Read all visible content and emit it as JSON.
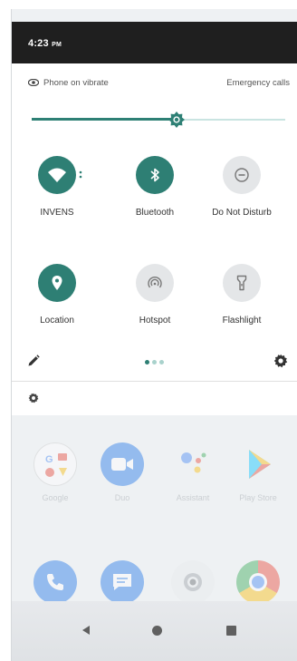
{
  "status_bar": {
    "time": "4:23",
    "ampm": "PM"
  },
  "quick_settings": {
    "ringer_status": "Phone on vibrate",
    "emergency_label": "Emergency calls",
    "brightness": {
      "level": 0.57
    },
    "tiles": [
      {
        "label": "INVENS",
        "icon": "wifi-icon",
        "active": true
      },
      {
        "label": "Bluetooth",
        "icon": "bluetooth-icon",
        "active": true
      },
      {
        "label": "Do Not Disturb",
        "icon": "do-not-disturb-icon",
        "active": false
      },
      {
        "label": "Location",
        "icon": "location-icon",
        "active": true
      },
      {
        "label": "Hotspot",
        "icon": "hotspot-icon",
        "active": false
      },
      {
        "label": "Flashlight",
        "icon": "flashlight-icon",
        "active": false
      }
    ],
    "page_indicator": {
      "count": 3,
      "current": 0
    }
  },
  "home_apps": [
    {
      "label": "Google",
      "icon": "google-folder-icon"
    },
    {
      "label": "Duo",
      "icon": "duo-icon"
    },
    {
      "label": "Assistant",
      "icon": "assistant-icon"
    },
    {
      "label": "Play Store",
      "icon": "play-store-icon"
    }
  ],
  "dock_apps": [
    {
      "icon": "phone-icon"
    },
    {
      "icon": "messages-icon"
    },
    {
      "icon": "camera-icon"
    },
    {
      "icon": "chrome-icon"
    }
  ],
  "colors": {
    "accent": "#2e7f74",
    "inactive_tile": "#e4e6e8",
    "status_bar": "#1f1f1f"
  }
}
